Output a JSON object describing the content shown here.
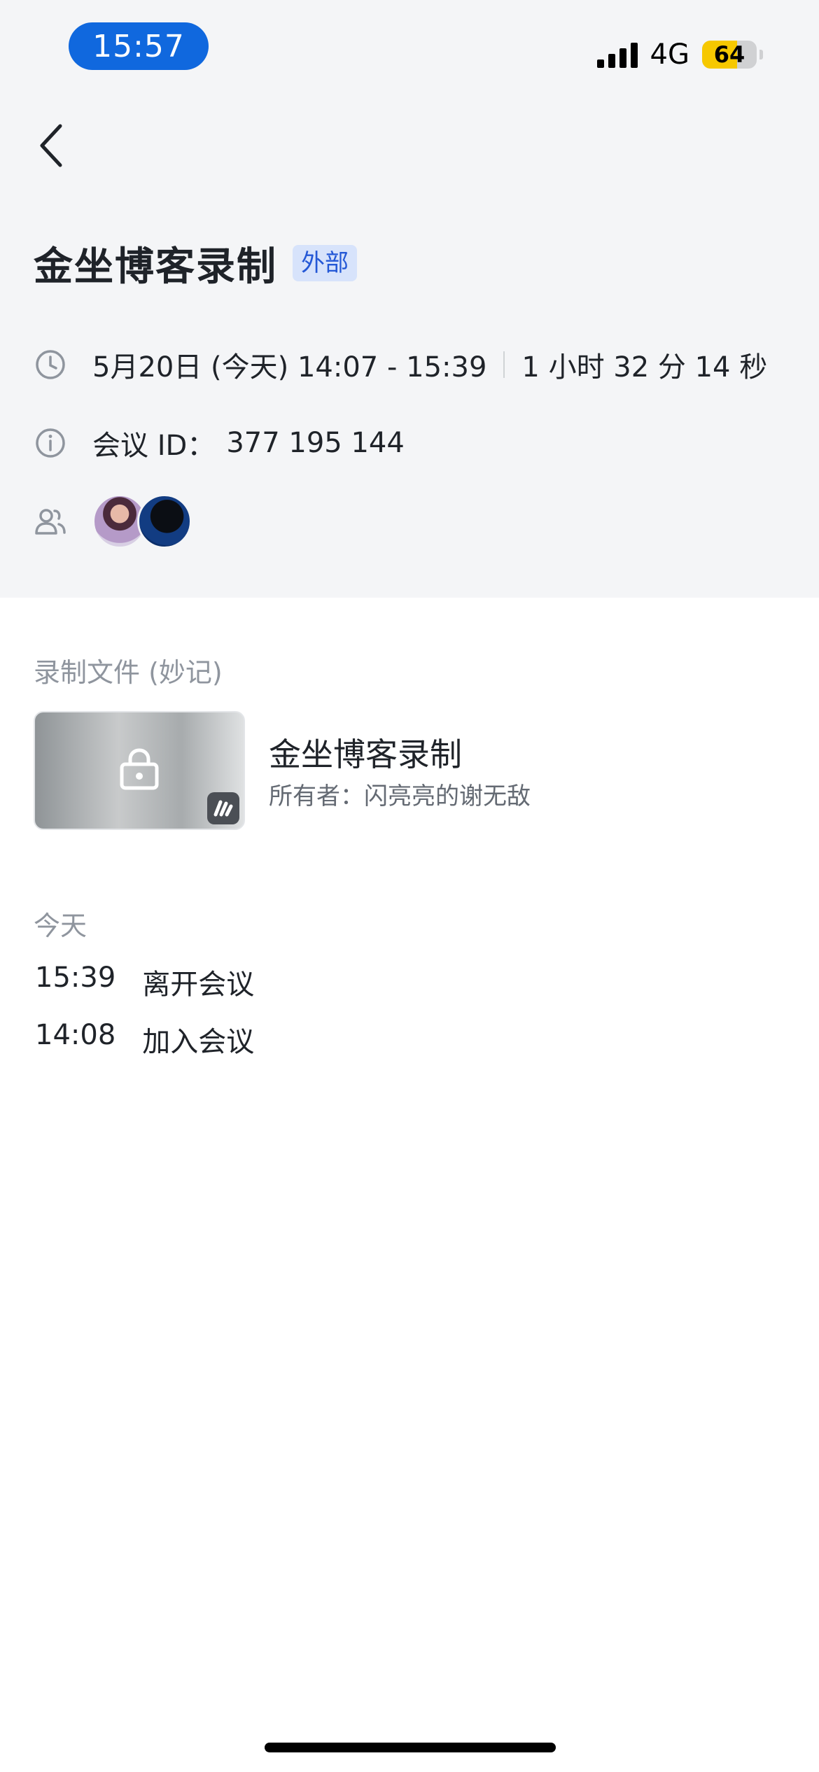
{
  "status_bar": {
    "time": "15:57",
    "network": "4G",
    "battery": "64"
  },
  "meeting": {
    "title": "金坐博客录制",
    "badge": "外部",
    "date_time": "5月20日 (今天) 14:07 - 15:39",
    "duration": "1 小时 32 分 14 秒",
    "id_label": "会议 ID：",
    "id_value": "377 195 144"
  },
  "recording": {
    "section_label": "录制文件 (妙记)",
    "title": "金坐博客录制",
    "owner": "所有者：闪亮亮的谢无敌"
  },
  "history": {
    "day_label": "今天",
    "events": [
      {
        "time": "15:39",
        "action": "离开会议"
      },
      {
        "time": "14:08",
        "action": "加入会议"
      }
    ]
  },
  "icons": {
    "back": "chevron-left-icon",
    "clock": "clock-icon",
    "info": "info-icon",
    "participants": "people-icon",
    "lock": "lock-icon"
  },
  "colors": {
    "accent": "#1068de",
    "badge_bg": "#d7e3fb",
    "badge_text": "#2458d6"
  }
}
